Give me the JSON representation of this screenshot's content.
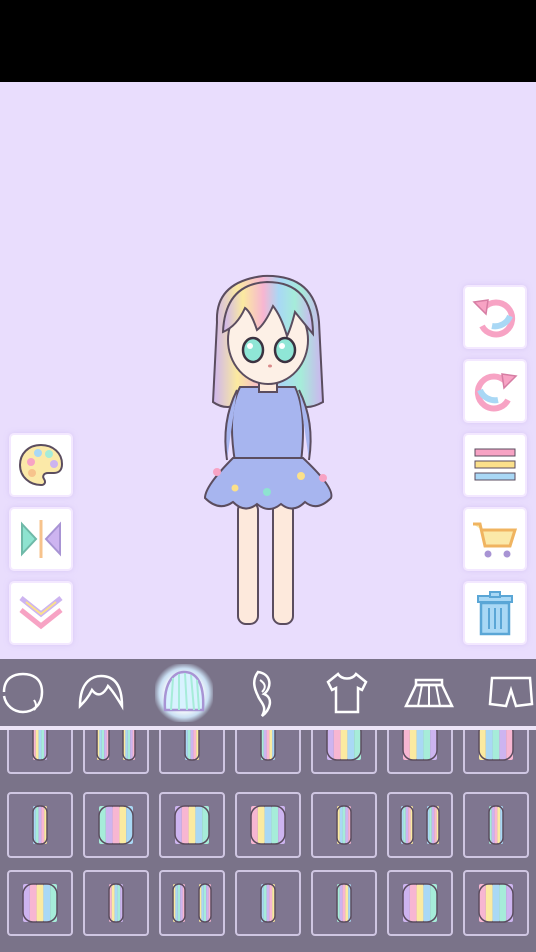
{
  "app": {
    "title": ""
  },
  "colors": {
    "stage_bg": "#e9ddfd",
    "tabbar_bg": "#7a7389",
    "cell_border": "#cfc6e2",
    "pastel_pink": "#f7b6d2",
    "pastel_yellow": "#fbeaa0",
    "pastel_blue": "#a9d8f5",
    "pastel_mint": "#a6ecd9",
    "pastel_lavender": "#cdb4f0",
    "dress_blue": "#a7b5ef"
  },
  "left_tools": [
    {
      "name": "palette-button",
      "icon": "palette-icon"
    },
    {
      "name": "flip-button",
      "icon": "mirror-flip-icon"
    },
    {
      "name": "collapse-button",
      "icon": "double-chevron-down-icon"
    }
  ],
  "right_tools": [
    {
      "name": "undo-button",
      "icon": "undo-icon"
    },
    {
      "name": "redo-button",
      "icon": "redo-icon"
    },
    {
      "name": "menu-button",
      "icon": "menu-icon"
    },
    {
      "name": "shop-button",
      "icon": "cart-icon"
    },
    {
      "name": "delete-button",
      "icon": "trash-icon"
    }
  ],
  "categories": [
    {
      "name": "tab-face",
      "icon": "face-outline-icon",
      "active": false
    },
    {
      "name": "tab-bangs",
      "icon": "bangs-icon",
      "active": false
    },
    {
      "name": "tab-hair",
      "icon": "hair-icon",
      "active": true
    },
    {
      "name": "tab-ponytail",
      "icon": "ponytail-icon",
      "active": false
    },
    {
      "name": "tab-top",
      "icon": "tshirt-icon",
      "active": false
    },
    {
      "name": "tab-skirt",
      "icon": "skirt-icon",
      "active": false
    },
    {
      "name": "tab-pants",
      "icon": "shorts-icon",
      "active": false
    }
  ],
  "items": {
    "row_count": 3,
    "columns": 7
  }
}
